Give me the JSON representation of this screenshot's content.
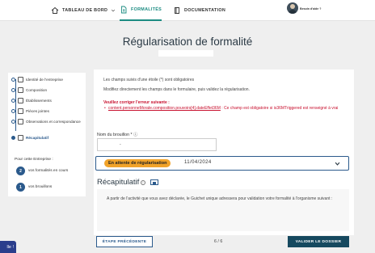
{
  "nav": {
    "items": [
      {
        "label": "TABLEAU DE BORD",
        "icon": "home-icon",
        "has_dropdown": true
      },
      {
        "label": "FORMALITÉS",
        "icon": "document-icon",
        "active": true
      },
      {
        "label": "DOCUMENTATION",
        "icon": "book-icon"
      }
    ],
    "user_label": "Besoin d'aide ?"
  },
  "page": {
    "title": "Régularisation de formalité"
  },
  "sidebar": {
    "steps": [
      {
        "label": "Identité de l'entreprise",
        "icon": "building-icon"
      },
      {
        "label": "Composition",
        "icon": "people-icon"
      },
      {
        "label": "Établissements",
        "icon": "store-icon"
      },
      {
        "label": "Pièces jointes",
        "icon": "paperclip-icon"
      },
      {
        "label": "Observations et correspondance",
        "icon": "mail-icon"
      },
      {
        "label": "Récapitulatif",
        "icon": "checklist-icon",
        "active": true
      }
    ],
    "heading": "Pour cette Entreprise :",
    "stats": [
      {
        "count": "2",
        "label": "vos formalités en cours"
      },
      {
        "count": "1",
        "label": "vos brouillons"
      }
    ]
  },
  "main": {
    "intro_required": "Les champs suivis d'une étoile (*) sont obligatoires",
    "intro_modify": "Modifiez directement les champs dans le formulaire, puis validez la régularisation.",
    "error_title": "Veuillez corriger l'erreur suivante :",
    "error_link": "content.personneMorale.composition.pouvoirs[4].dateEffet36M",
    "error_text": " : Ce champ est obligatoire si is36MTriggered est renseigné à vrai",
    "draft_label": "Nom du brouillon * ⓘ",
    "draft_value": "-",
    "status_badge": "En attente de régularisation",
    "status_date": "11/04/2024",
    "section_title": "Récapitulatif",
    "recap_text": "A partir de l'activité que vous avez déclarée, le Guichet unique adressera pour validation votre formalité à l'organisme suivant :"
  },
  "footer": {
    "prev_label": "ÉTAPE PRÉCÉDENTE",
    "pager": "6 / 6",
    "next_label": "VALIDER LE DOSSIER",
    "help_label": "lle !"
  },
  "colors": {
    "accent": "#1c8c82",
    "primary": "#2b5a8c",
    "error": "#c8102e",
    "badge": "#f1a32a",
    "button_dark": "#16495f"
  }
}
